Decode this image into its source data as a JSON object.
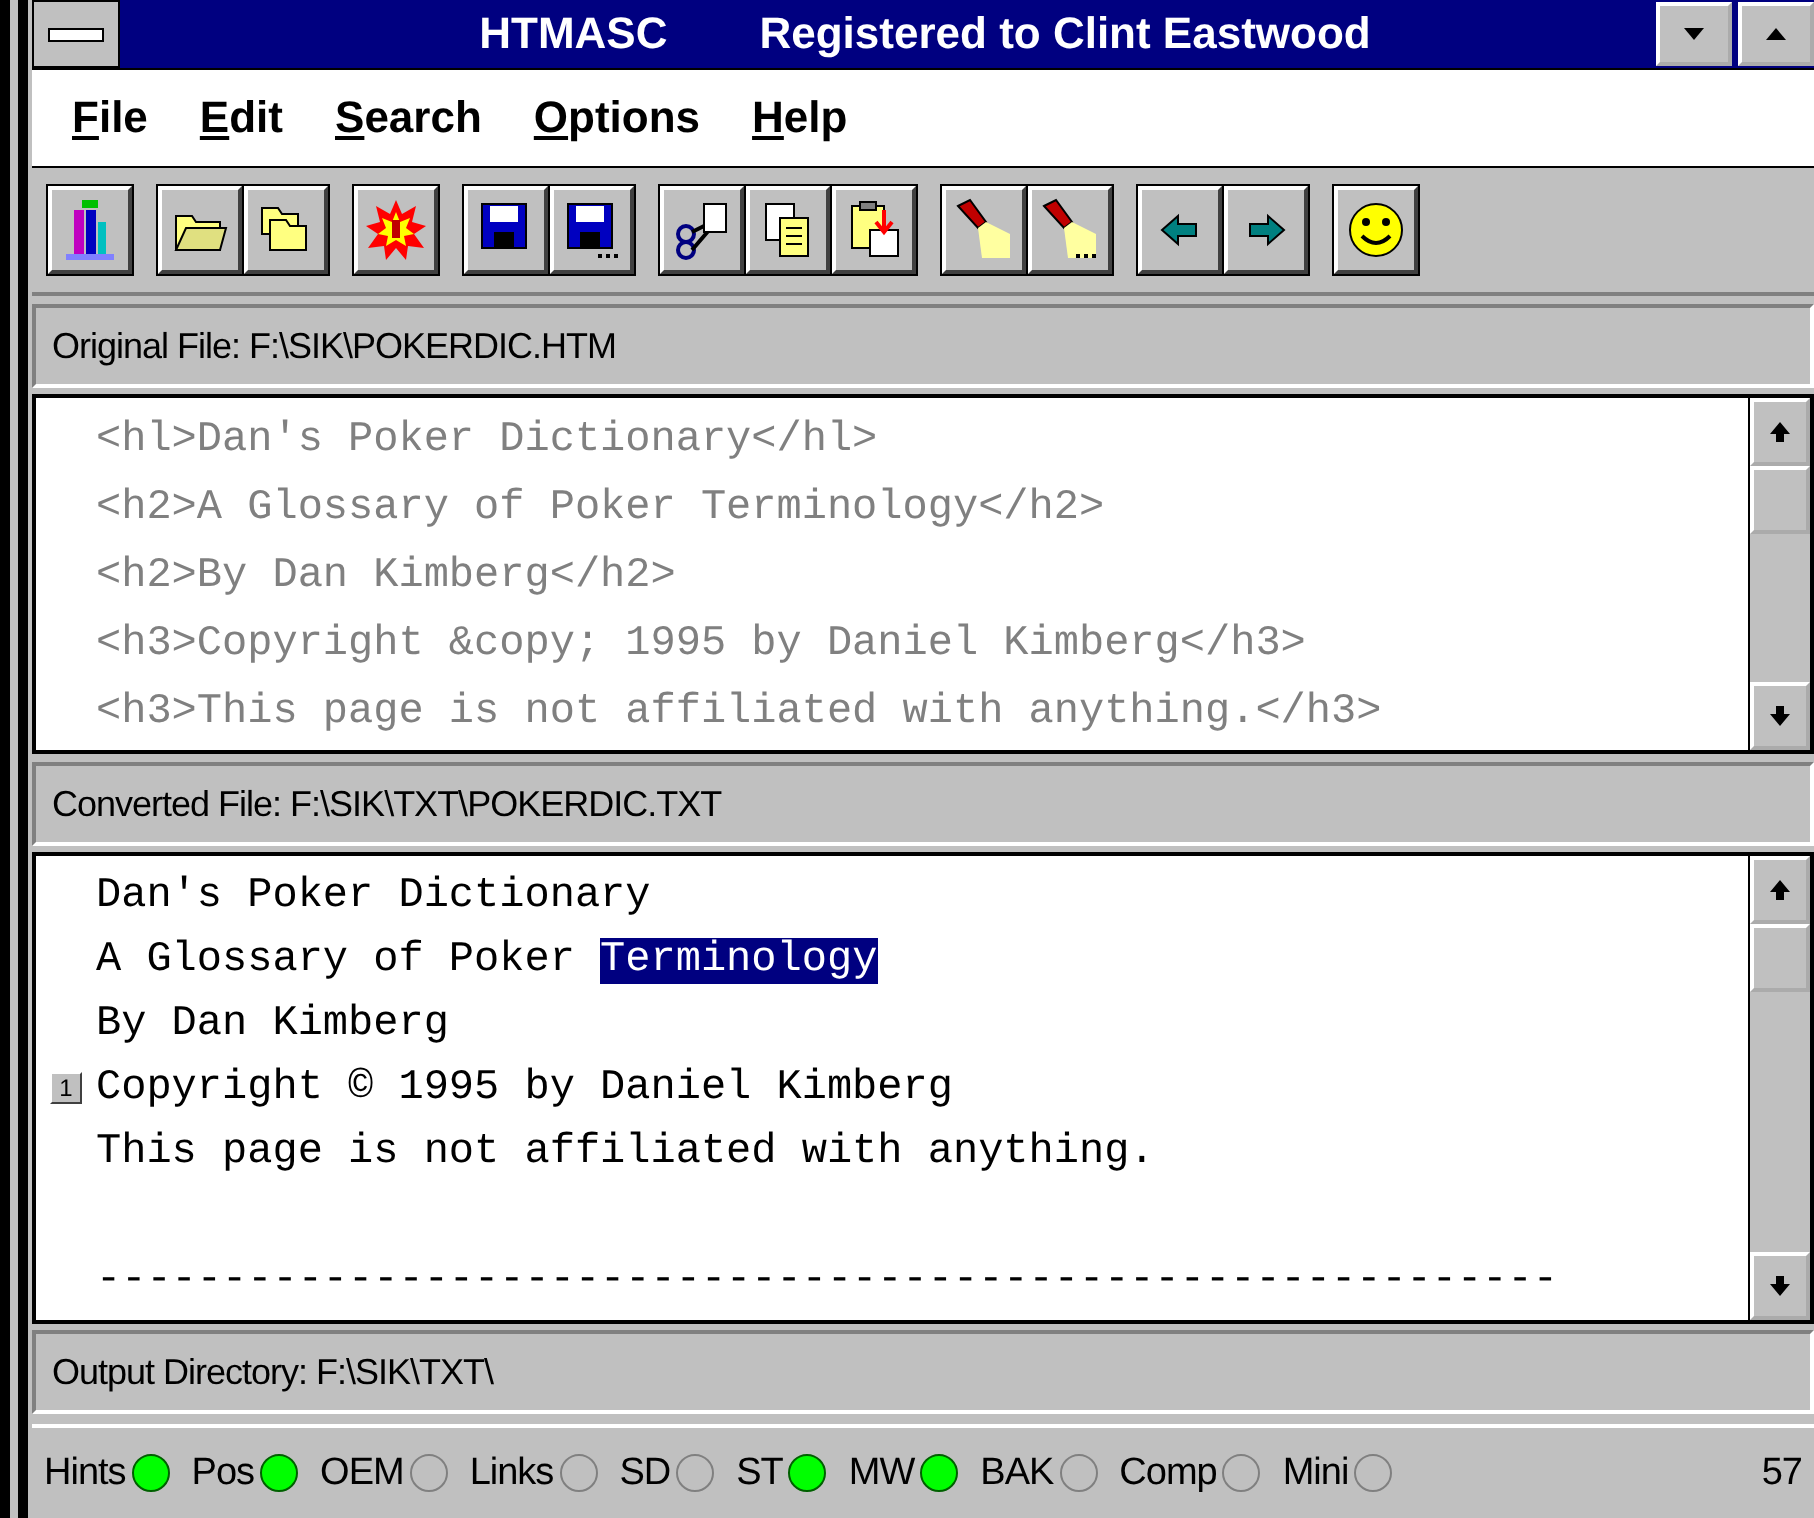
{
  "window": {
    "title_app": "HTMASC",
    "title_registration": "Registered to Clint Eastwood"
  },
  "menu": [
    {
      "label": "File"
    },
    {
      "label": "Edit"
    },
    {
      "label": "Search"
    },
    {
      "label": "Options"
    },
    {
      "label": "Help"
    }
  ],
  "original": {
    "label": "Original File: F:\\SIK\\POKERDIC.HTM",
    "lines": [
      "<hl>Dan's Poker Dictionary</hl>",
      "<h2>A Glossary of Poker Terminology</h2>",
      "<h2>By Dan Kimberg</h2>",
      "<h3>Copyright &copy; 1995 by Daniel Kimberg</h3>",
      "<h3>This page is not affiliated with anything.</h3>"
    ]
  },
  "converted": {
    "label": "Converted File: F:\\SIK\\TXT\\POKERDIC.TXT",
    "lines": [
      {
        "kind": "text",
        "segments": [
          {
            "text": "Dan's Poker Dictionary",
            "selected": false
          }
        ]
      },
      {
        "kind": "text",
        "segments": [
          {
            "text": "A Glossary of Poker ",
            "selected": false
          },
          {
            "text": "Terminology",
            "selected": true
          }
        ]
      },
      {
        "kind": "text",
        "segments": [
          {
            "text": "By Dan Kimberg",
            "selected": false
          }
        ]
      },
      {
        "kind": "text",
        "marker": "1",
        "segments": [
          {
            "text": "Copyright © 1995 by Daniel Kimberg",
            "selected": false
          }
        ]
      },
      {
        "kind": "text",
        "segments": [
          {
            "text": "This page is not affiliated with anything.",
            "selected": false
          }
        ]
      },
      {
        "kind": "blank"
      },
      {
        "kind": "text",
        "segments": [
          {
            "text": "----------------------------------------------------------",
            "selected": false
          }
        ]
      }
    ]
  },
  "output": {
    "label": "Output Directory: F:\\SIK\\TXT\\"
  },
  "status": {
    "indicators": [
      {
        "label": "Hints",
        "on": true
      },
      {
        "label": "Pos",
        "on": true
      },
      {
        "label": "OEM",
        "on": false
      },
      {
        "label": "Links",
        "on": false
      },
      {
        "label": "SD",
        "on": false
      },
      {
        "label": "ST",
        "on": true
      },
      {
        "label": "MW",
        "on": true
      },
      {
        "label": "BAK",
        "on": false
      },
      {
        "label": "Comp",
        "on": false
      },
      {
        "label": "Mini",
        "on": false
      }
    ],
    "count": "57"
  }
}
